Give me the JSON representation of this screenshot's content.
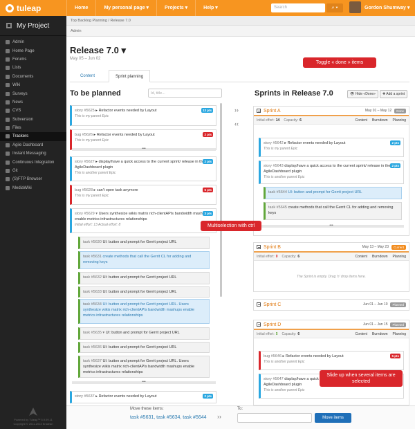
{
  "header": {
    "logo": "tuleap",
    "nav": [
      "Home",
      "My personal page ▾",
      "Projects ▾",
      "Help ▾"
    ],
    "search_placeholder": "Search",
    "search_btn": "⌕ ▾",
    "user": "Gordon Shumway ▾"
  },
  "sidebar": {
    "project": "My Project",
    "items": [
      "Admin",
      "Home Page",
      "Forums",
      "Lists",
      "Documents",
      "Wiki",
      "Surveys",
      "News",
      "CVS",
      "Subversion",
      "Files",
      "Trackers",
      "Agile Dashboard",
      "Instant Messaging",
      "Continuous Integration",
      "Git",
      "(S)FTP Browser",
      "MediaWiki"
    ],
    "active": "Trackers",
    "footer1": "Powered by Tuleap™ 5.9.99.11",
    "footer2": "Copyright © 2011-2013 Enalean"
  },
  "breadcrumb": "Top Backlog Planning / Release 7.0",
  "admin_bar": "Admin",
  "page": {
    "title": "Release 7.0 ▾",
    "dates": "May 05 – Jun 02",
    "tabs": [
      "Content",
      "Sprint planning"
    ]
  },
  "left": {
    "heading": "To be planned",
    "search_placeholder": "Id, title..."
  },
  "right": {
    "heading": "Sprints in Release 7.0",
    "hide_btn": "👁 Hide «Done»",
    "add_btn": "✚ Add a sprint"
  },
  "backlog": [
    {
      "id": "story #5625",
      "title": "Refactor events needed by Layout",
      "epic": "This is my parent Epic",
      "pts": "13 pts"
    },
    {
      "id": "bug #5626",
      "title": "Refactor events needed by Layout",
      "epic": "This is my parent Epic",
      "pts": "2 pts"
    },
    {
      "id": "story #5627",
      "title": "display/have a quick access to the current sprint/ release in the AgileDashboard plugin",
      "epic": "This is another parent Epic",
      "pts": "2 pts"
    },
    {
      "id": "bug #5628",
      "title": "can't open task anymore",
      "epic": "This is my parent Epic",
      "pts": "5 pts"
    },
    {
      "id": "story #5629 ▾",
      "title": "Users synthesize wikis matrix rich-clientAPIs bandwidth mashups enable metrics infrastructures relationships",
      "epic": "Initial effort: 13   Actual effort: 8",
      "pts": "3 pts"
    }
  ],
  "tasks": [
    {
      "id": "task #5630",
      "title": "UI: button and prompt for Gerrit project URL"
    },
    {
      "id": "task #5631",
      "title": "create methods that call the Gerrit CL for adding and removing keys"
    },
    {
      "id": "task #5632",
      "title": "UI: button and prompt for Gerrit project URL"
    },
    {
      "id": "task #5633",
      "title": "UI: button and prompt for Gerrit project URL"
    },
    {
      "id": "task #5634",
      "title": "UI: button and prompt for Gerrit project URL. Users synthesize wikis matrix rich-clientAPIs bandwidth mashups enable metrics infrastructures relationships"
    },
    {
      "id": "task #5635 ▾",
      "title": "UI: button and prompt for Gerrit project URL"
    },
    {
      "id": "task #5636",
      "title": "UI: button and prompt for Gerrit project URL"
    },
    {
      "id": "task #5637",
      "title": "UI: button and prompt for Gerrit project URL. Users synthesize wikis matrix rich-clientAPIs bandwidth mashups enable metrics infrastructures relationships"
    }
  ],
  "last_story": {
    "id": "story #5637",
    "title": "Refactor events needed by Layout",
    "pts": "2 pts"
  },
  "sprints": [
    {
      "name": "Sprint A",
      "dates": "May 01 – May 12",
      "status": "Done",
      "status_color": "#9a9a9a",
      "initial": "14",
      "capacity": "6"
    },
    {
      "name": "Sprint B",
      "dates": "May 13 – May 23",
      "status": "Current",
      "status_color": "#f28c1e",
      "initial": "0",
      "capacity": "6",
      "empty": "The Sprint is empty. Drag 'n' drop items here."
    },
    {
      "name": "Sprint C",
      "dates": "Jun 01 – Jun 10",
      "status": "Planned",
      "status_color": "#9a9a9a"
    },
    {
      "name": "Sprint D",
      "dates": "Jun 01 – Jun 15",
      "status": "Planned",
      "status_color": "#9a9a9a",
      "initial": "5",
      "capacity": "6"
    }
  ],
  "sprint_labels": {
    "initial": "Initial effort:",
    "capacity": "Capacity:",
    "content": "Content",
    "burndown": "Burndown",
    "planning": "Planning"
  },
  "sprintA_items": [
    {
      "id": "story #5642",
      "title": "Refactor events needed by Layout",
      "epic": "This is my parent Epic",
      "pts": "2 pts"
    },
    {
      "id": "story #5643",
      "title": "display/have a quick access to the current sprint/ release in the AgileDashboard plugin",
      "epic": "This is another parent Epic",
      "pts": "2 pts"
    },
    {
      "id": "task #5644",
      "title": "UI: button and prompt for Gerrit project URL"
    },
    {
      "id": "task #5645",
      "title": "create methods that call the Gerrit CL for adding and removing keys"
    }
  ],
  "sprintD_items": [
    {
      "id": "bug #5646",
      "title": "Refactor events needed by Layout",
      "epic": "This is another parent Epic",
      "pts": "5 pts"
    },
    {
      "id": "story #5647",
      "title": "display/have a quick access to the current sprint/ release in the AgileDashboard plugin",
      "epic": "This is another parent Epic",
      "pts": "2 pts"
    }
  ],
  "callouts": {
    "toggle": "Toggle « done » items",
    "multi": "Multiselection with ctrl",
    "slide": "Slide up when several items are selected"
  },
  "move": {
    "label": "Move these items:",
    "items": "task #5631, task #5634, task #5644",
    "to": "To:",
    "btn": "Move items"
  }
}
